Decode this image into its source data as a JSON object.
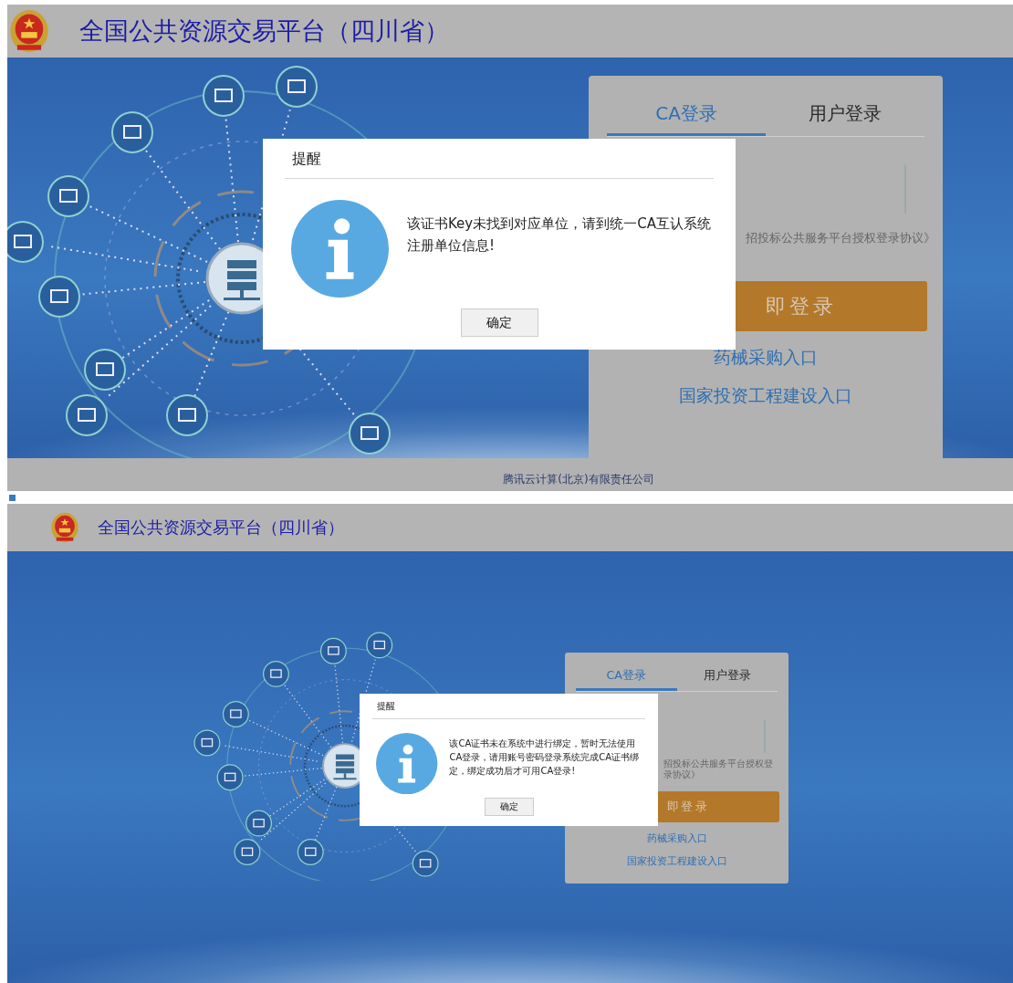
{
  "screens": [
    {
      "header": {
        "title": "全国公共资源交易平台（四川省）"
      },
      "login": {
        "tabs": [
          {
            "label": "CA登录",
            "selected": true
          },
          {
            "label": "用户登录",
            "selected": false
          }
        ],
        "agreement": "招投标公共服务平台授权登录协议》",
        "login_button": "即登录",
        "links": [
          "药械采购入口",
          "国家投资工程建设入口"
        ]
      },
      "dialog": {
        "title": "提醒",
        "message": "该证书Key未找到对应单位，请到统一CA互认系统注册单位信息!",
        "button": "确定"
      },
      "footer": "腾讯云计算(北京)有限责任公司"
    },
    {
      "header": {
        "title": "全国公共资源交易平台（四川省）"
      },
      "login": {
        "tabs": [
          {
            "label": "CA登录",
            "selected": true
          },
          {
            "label": "用户登录",
            "selected": false
          }
        ],
        "agreement": "招投标公共服务平台授权登录协议》",
        "login_button": "即登录",
        "links": [
          "药械采购入口",
          "国家投资工程建设入口"
        ]
      },
      "dialog": {
        "title": "提醒",
        "message": "该CA证书未在系统中进行绑定，暂时无法使用CA登录，请用账号密码登录系统完成CA证书绑定，绑定成功后才可用CA登录!",
        "button": "确定"
      }
    }
  ]
}
